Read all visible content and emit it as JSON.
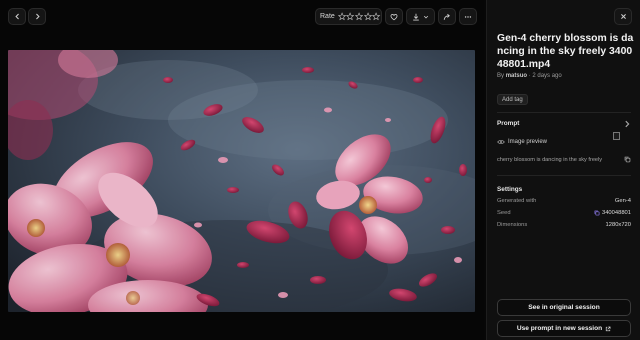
{
  "toolbar": {
    "rate_label": "Rate",
    "stars": 5,
    "rating": 0
  },
  "asset": {
    "title": "Gen-4 cherry blossom is dancing in the sky freely 340048801.mp4",
    "by_prefix": "By",
    "author": "matsuo",
    "separator": " · ",
    "age": "2 days ago",
    "add_tag_label": "Add tag"
  },
  "prompt_section": {
    "heading": "Prompt",
    "image_preview_label": "Image preview",
    "prompt_text": "cherry blossom is dancing in the sky freely"
  },
  "settings": {
    "heading": "Settings",
    "rows": [
      {
        "key": "Generated with",
        "value": "Gen-4"
      },
      {
        "key": "Seed",
        "value": "340048801"
      },
      {
        "key": "Dimensions",
        "value": "1280x720"
      }
    ]
  },
  "actions": {
    "see_original": "See in original session",
    "use_prompt": "Use prompt in new session"
  },
  "colors": {
    "petal": "#c23a6e",
    "petal_light": "#e79ab6",
    "sky": "#3d4c5e"
  },
  "icons": [
    "chevron-left-icon",
    "chevron-right-icon",
    "star-icon",
    "heart-icon",
    "download-icon",
    "chevron-down-icon",
    "share-icon",
    "more-icon",
    "close-icon",
    "eye-icon",
    "copy-icon",
    "external-link-icon"
  ]
}
